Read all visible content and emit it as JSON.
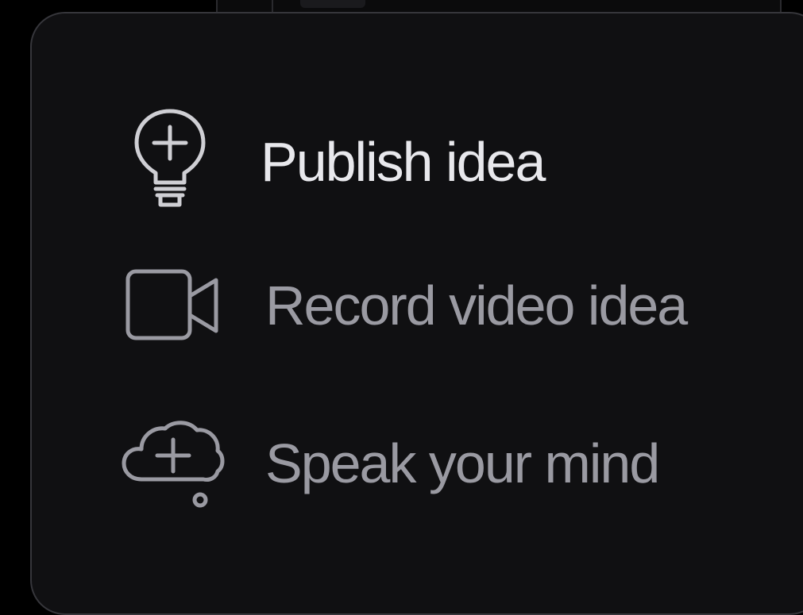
{
  "colors": {
    "background": "#000000",
    "menu_bg": "#101012",
    "menu_border": "#36363b",
    "primary_text": "#e8e8ec",
    "secondary_text": "#9a9aa2"
  },
  "menu": {
    "items": [
      {
        "label": "Publish idea",
        "icon": "lightbulb-plus-icon"
      },
      {
        "label": "Record video idea",
        "icon": "video-camera-icon"
      },
      {
        "label": "Speak your mind",
        "icon": "thought-cloud-plus-icon"
      }
    ]
  }
}
